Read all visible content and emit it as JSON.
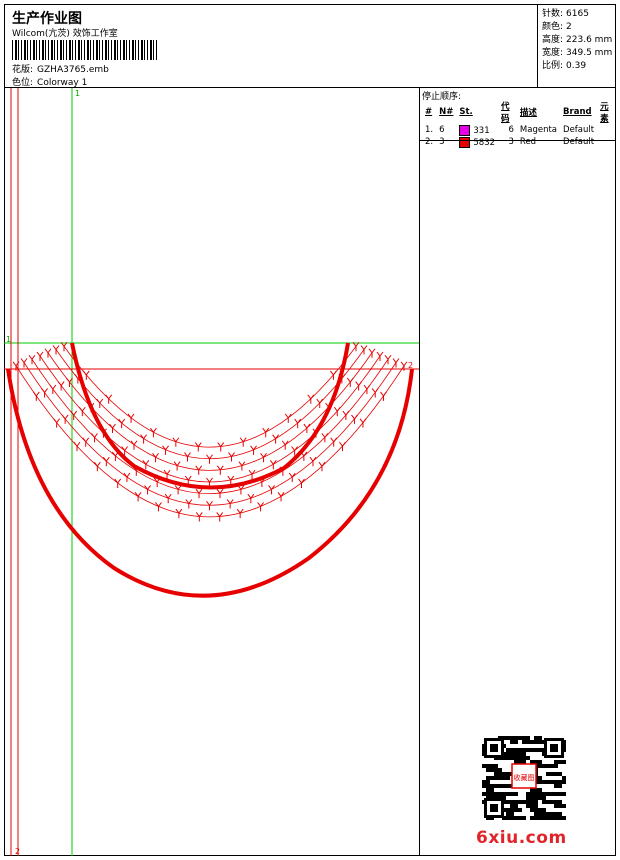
{
  "header": {
    "title": "生产作业图",
    "studio": "Wilcom(亢茨) 效饰工作室",
    "design_label": "花版:",
    "design_value": "GZHA3765.emb",
    "colorway_label": "色位:",
    "colorway_value": "Colorway 1"
  },
  "stats": [
    {
      "label": "针数:",
      "value": "6165"
    },
    {
      "label": "颜色:",
      "value": "2"
    },
    {
      "label": "高度:",
      "value": "223.6 mm"
    },
    {
      "label": "宽度:",
      "value": "349.5 mm"
    },
    {
      "label": "比例:",
      "value": "0.39"
    }
  ],
  "stop_sequence": {
    "title": "停止顺序:",
    "headers": [
      "#",
      "N#",
      "St.",
      "代码",
      "描述",
      "Brand",
      "元素"
    ],
    "rows": [
      {
        "num": "1.",
        "needle": "6",
        "color": "#e600e6",
        "stitches": "331",
        "code": "6",
        "desc": "Magenta",
        "brand": "Default",
        "element": ""
      },
      {
        "num": "2.",
        "needle": "3",
        "color": "#e60000",
        "stitches": "5832",
        "code": "3",
        "desc": "Red",
        "brand": "Default",
        "element": ""
      }
    ]
  },
  "canvas": {
    "markers": [
      "1",
      "1",
      "2",
      "2"
    ],
    "guide_color": "#00cc00",
    "thread_color": "#e60000"
  },
  "watermark": "6xiu.com",
  "stamp_text": "收藏图"
}
